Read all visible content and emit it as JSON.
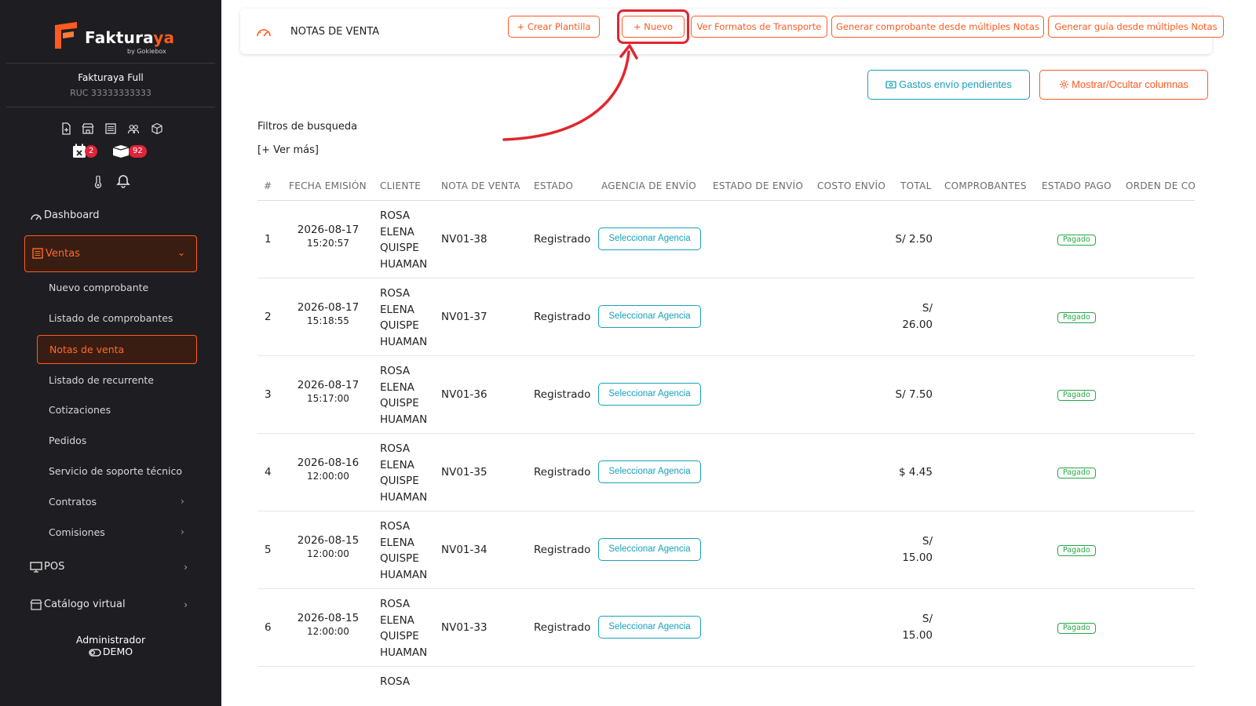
{
  "sidebar": {
    "logo_text_a": "Faktura",
    "logo_text_b": "ya",
    "logo_sub": "by Gokiebox",
    "company": "Fakturaya Full",
    "ruc": "RUC 33333333333",
    "badge_calendar": "2",
    "badge_box": "92",
    "menu": {
      "dashboard": "Dashboard",
      "ventas": "Ventas",
      "pos": "POS",
      "catalogo": "Catálogo virtual"
    },
    "ventas_items": [
      "Nuevo comprobante",
      "Listado de comprobantes",
      "Notas de venta",
      "Listado de recurrente",
      "Cotizaciones",
      "Pedidos",
      "Servicio de soporte técnico",
      "Contratos",
      "Comisiones"
    ],
    "user_role": "Administrador",
    "user_mode": "DEMO"
  },
  "header": {
    "title": "NOTAS DE VENTA",
    "buttons": {
      "crear_plantilla": "+ Crear Plantilla",
      "nuevo": "+  Nuevo",
      "ver_formatos": "Ver Formatos de Transporte",
      "generar_comprobante": "Generar comprobante desde múltiples Notas",
      "generar_guia": "Generar guía desde múltiples Notas"
    }
  },
  "actions": {
    "gastos": "Gastos envío pendientes",
    "columnas": "Mostrar/Ocultar columnas"
  },
  "filters": {
    "label": "Filtros de busqueda",
    "ver_mas": "[+ Ver más]"
  },
  "table": {
    "headers": [
      "#",
      "FECHA EMISIÓN",
      "CLIENTE",
      "NOTA DE VENTA",
      "ESTADO",
      "AGENCIA DE ENVÍO",
      "ESTADO DE ENVÍO",
      "COSTO ENVÍO",
      "TOTAL",
      "COMPROBANTES",
      "ESTADO PAGO",
      "ORDEN DE CO"
    ],
    "agency_label": "Seleccionar Agencia",
    "rows": [
      {
        "num": "1",
        "date": "2026-08-17",
        "time": "15:20:57",
        "client": "ROSA ELENA QUISPE HUAMAN",
        "nv": "NV01-38",
        "estado": "Registrado",
        "total_a": "S/ 2.50",
        "total_b": "",
        "pago": "Pagado"
      },
      {
        "num": "2",
        "date": "2026-08-17",
        "time": "15:18:55",
        "client": "ROSA ELENA QUISPE HUAMAN",
        "nv": "NV01-37",
        "estado": "Registrado",
        "total_a": "S/",
        "total_b": "26.00",
        "pago": "Pagado"
      },
      {
        "num": "3",
        "date": "2026-08-17",
        "time": "15:17:00",
        "client": "ROSA ELENA QUISPE HUAMAN",
        "nv": "NV01-36",
        "estado": "Registrado",
        "total_a": "S/ 7.50",
        "total_b": "",
        "pago": "Pagado"
      },
      {
        "num": "4",
        "date": "2026-08-16",
        "time": "12:00:00",
        "client": "ROSA ELENA QUISPE HUAMAN",
        "nv": "NV01-35",
        "estado": "Registrado",
        "total_a": "$ 4.45",
        "total_b": "",
        "pago": "Pagado"
      },
      {
        "num": "5",
        "date": "2026-08-15",
        "time": "12:00:00",
        "client": "ROSA ELENA QUISPE HUAMAN",
        "nv": "NV01-34",
        "estado": "Registrado",
        "total_a": "S/",
        "total_b": "15.00",
        "pago": "Pagado"
      },
      {
        "num": "6",
        "date": "2026-08-15",
        "time": "12:00:00",
        "client": "ROSA ELENA QUISPE HUAMAN",
        "nv": "NV01-33",
        "estado": "Registrado",
        "total_a": "S/",
        "total_b": "15.00",
        "pago": "Pagado"
      }
    ],
    "partial_row_client": "ROSA"
  },
  "colors": {
    "accent": "#ff5a1f",
    "teal": "#17a2b8",
    "success": "#28a745",
    "highlight": "#e2262f",
    "sidebar_bg": "#1e1e22"
  }
}
